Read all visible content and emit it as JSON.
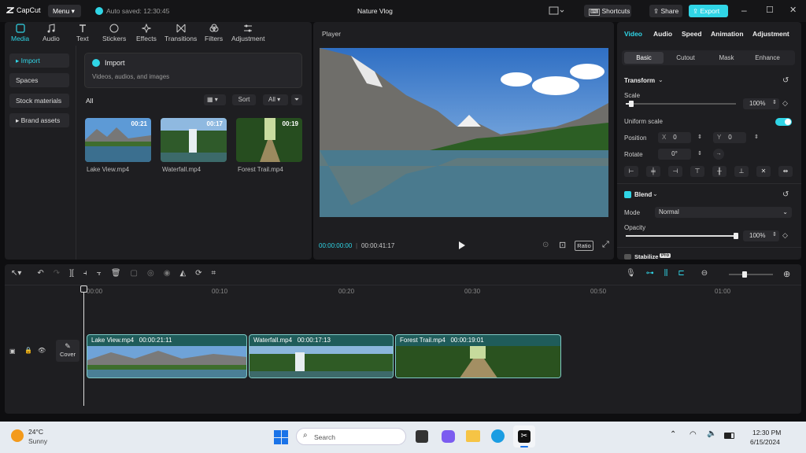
{
  "app": {
    "logo_text": "CapCut",
    "menu_label": "Menu",
    "autosave": "Auto saved: 12:30:45",
    "project_title": "Nature Vlog",
    "shortcuts_label": "Shortcuts",
    "share_label": "Share",
    "export_label": "Export"
  },
  "media_tabs": [
    {
      "label": "Media",
      "icon": "media-icon"
    },
    {
      "label": "Audio",
      "icon": "audio-icon"
    },
    {
      "label": "Text",
      "icon": "text-icon"
    },
    {
      "label": "Stickers",
      "icon": "stickers-icon"
    },
    {
      "label": "Effects",
      "icon": "effects-icon"
    },
    {
      "label": "Transitions",
      "icon": "transitions-icon"
    },
    {
      "label": "Filters",
      "icon": "filters-icon"
    },
    {
      "label": "Adjustment",
      "icon": "adjustment-icon"
    }
  ],
  "left_nav": {
    "import": "▸ Import",
    "spaces": "Spaces",
    "stock": "Stock materials",
    "brand": "▸ Brand assets"
  },
  "import_box": {
    "title": "Import",
    "subtitle": "Videos, audios, and images"
  },
  "library": {
    "filter_label": "All",
    "sort_label": "Sort",
    "all_dropdown": "All",
    "items": [
      {
        "name": "Lake View.mp4",
        "duration": "00:21"
      },
      {
        "name": "Waterfall.mp4",
        "duration": "00:17"
      },
      {
        "name": "Forest Trail.mp4",
        "duration": "00:19"
      }
    ]
  },
  "player": {
    "title": "Player",
    "current_time": "00:00:00:00",
    "total_time": "00:00:41:17",
    "ratio_label": "Ratio"
  },
  "inspector": {
    "tabs": [
      "Video",
      "Audio",
      "Speed",
      "Animation",
      "Adjustment"
    ],
    "subtabs": [
      "Basic",
      "Cutout",
      "Mask",
      "Enhance"
    ],
    "transform_label": "Transform",
    "scale_label": "Scale",
    "scale_value": "100%",
    "scale_fraction": 0.05,
    "uniform_scale_label": "Uniform scale",
    "uniform_scale_on": true,
    "position_label": "Position",
    "pos_x_label": "X",
    "pos_x": "0",
    "pos_y_label": "Y",
    "pos_y": "0",
    "rotate_label": "Rotate",
    "rotate_value": "0°",
    "blend_label": "Blend",
    "mode_label": "Mode",
    "mode_value": "Normal",
    "opacity_label": "Opacity",
    "opacity_value": "100%",
    "opacity_fraction": 1.0,
    "stabilize_label": "Stabilize",
    "pro_badge": "Pro"
  },
  "timeline": {
    "ruler": [
      "00:00",
      "00:10",
      "00:20",
      "00:30",
      "00:50",
      "01:00"
    ],
    "cover_label": "Cover",
    "clips": [
      {
        "name": "Lake View.mp4",
        "duration": "00:00:21:11"
      },
      {
        "name": "Waterfall.mp4",
        "duration": "00:00:17:13"
      },
      {
        "name": "Forest Trail.mp4",
        "duration": "00:00:19:01"
      }
    ]
  },
  "taskbar": {
    "temp": "24°C",
    "weather": "Sunny",
    "search_placeholder": "Search",
    "time": "12:30 PM",
    "date": "6/15/2024"
  },
  "colors": {
    "accent": "#30d5e6",
    "clip": "#1f5c5a",
    "clip_border": "#7fc9c5"
  }
}
